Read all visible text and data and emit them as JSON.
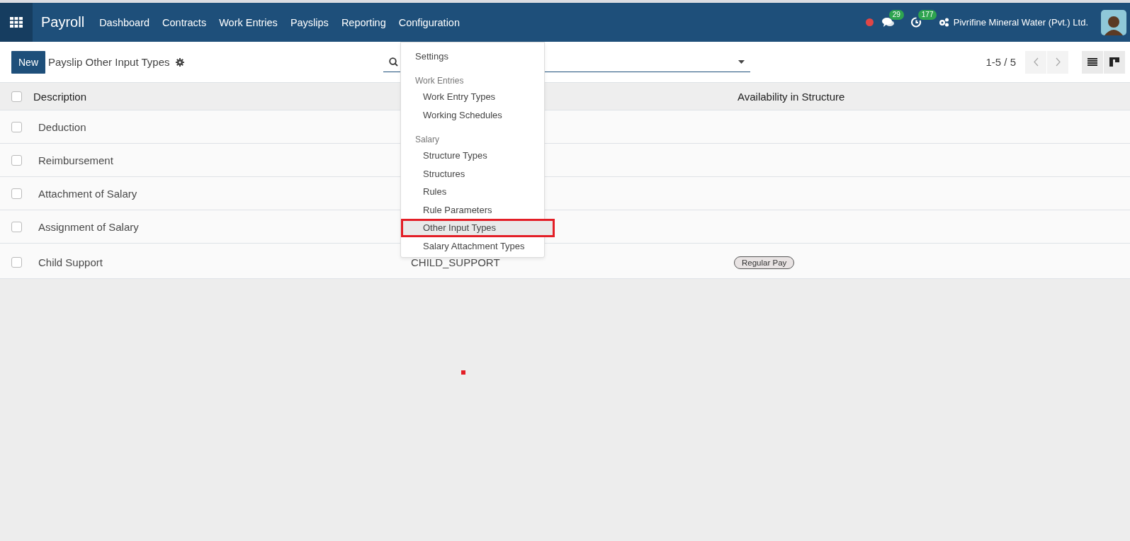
{
  "navbar": {
    "app_name": "Payroll",
    "menu": [
      "Dashboard",
      "Contracts",
      "Work Entries",
      "Payslips",
      "Reporting",
      "Configuration"
    ],
    "chat_count": "29",
    "activity_count": "177",
    "company": "Pivrifine Mineral Water (Pvt.) Ltd."
  },
  "control_panel": {
    "new_button": "New",
    "title": "Payslip Other Input Types",
    "pager": "1-5 / 5"
  },
  "dropdown": [
    {
      "kind": "item",
      "label": "Settings",
      "selected": false
    },
    {
      "kind": "header",
      "label": "Work Entries"
    },
    {
      "kind": "subitem",
      "label": "Work Entry Types",
      "selected": false
    },
    {
      "kind": "subitem",
      "label": "Working Schedules",
      "selected": false
    },
    {
      "kind": "header",
      "label": "Salary"
    },
    {
      "kind": "subitem",
      "label": "Structure Types",
      "selected": false
    },
    {
      "kind": "subitem",
      "label": "Structures",
      "selected": false
    },
    {
      "kind": "subitem",
      "label": "Rules",
      "selected": false
    },
    {
      "kind": "subitem",
      "label": "Rule Parameters",
      "selected": false
    },
    {
      "kind": "subitem",
      "label": "Other Input Types",
      "selected": true
    },
    {
      "kind": "subitem",
      "label": "Salary Attachment Types",
      "selected": false
    }
  ],
  "table": {
    "select_all_checked": false,
    "columns": [
      "Description",
      "Availability in Structure"
    ],
    "rows": [
      {
        "description": "Deduction",
        "checked": false
      },
      {
        "description": "Reimbursement",
        "checked": false
      },
      {
        "description": "Attachment of Salary",
        "checked": false
      },
      {
        "description": "Assignment of Salary",
        "checked": false
      },
      {
        "description": "Child Support",
        "column_2": "CHILD_SUPPORT",
        "tags": [
          "Regular Pay"
        ],
        "checked": false
      }
    ]
  }
}
